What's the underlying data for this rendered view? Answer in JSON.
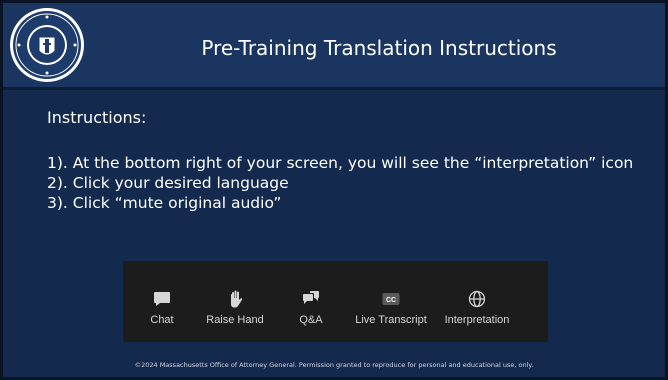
{
  "slide": {
    "title": "Pre-Training Translation Instructions",
    "seal_icon": "massachusetts-seal-icon"
  },
  "instructions": {
    "heading": "Instructions:",
    "steps": [
      "1). At the bottom right of your screen, you will see the “interpretation” icon",
      "2). Click your desired language",
      "3). Click “mute original audio”"
    ]
  },
  "toolbar": {
    "items": [
      {
        "label": "Chat",
        "icon": "chat-icon"
      },
      {
        "label": "Raise Hand",
        "icon": "raise-hand-icon"
      },
      {
        "label": "Q&A",
        "icon": "qa-icon"
      },
      {
        "label": "Live Transcript",
        "icon": "closed-caption-icon",
        "icon_text": "CC"
      },
      {
        "label": "Interpretation",
        "icon": "globe-icon"
      }
    ]
  },
  "footer": {
    "text": "©2024 Massachusetts Office of Attorney General. Permission granted to reproduce for personal and educational use, only."
  },
  "colors": {
    "background": "#132a4e",
    "header": "#1a3660",
    "toolbar": "#1c1c1c",
    "toolbar_text": "#d6d6d6"
  }
}
